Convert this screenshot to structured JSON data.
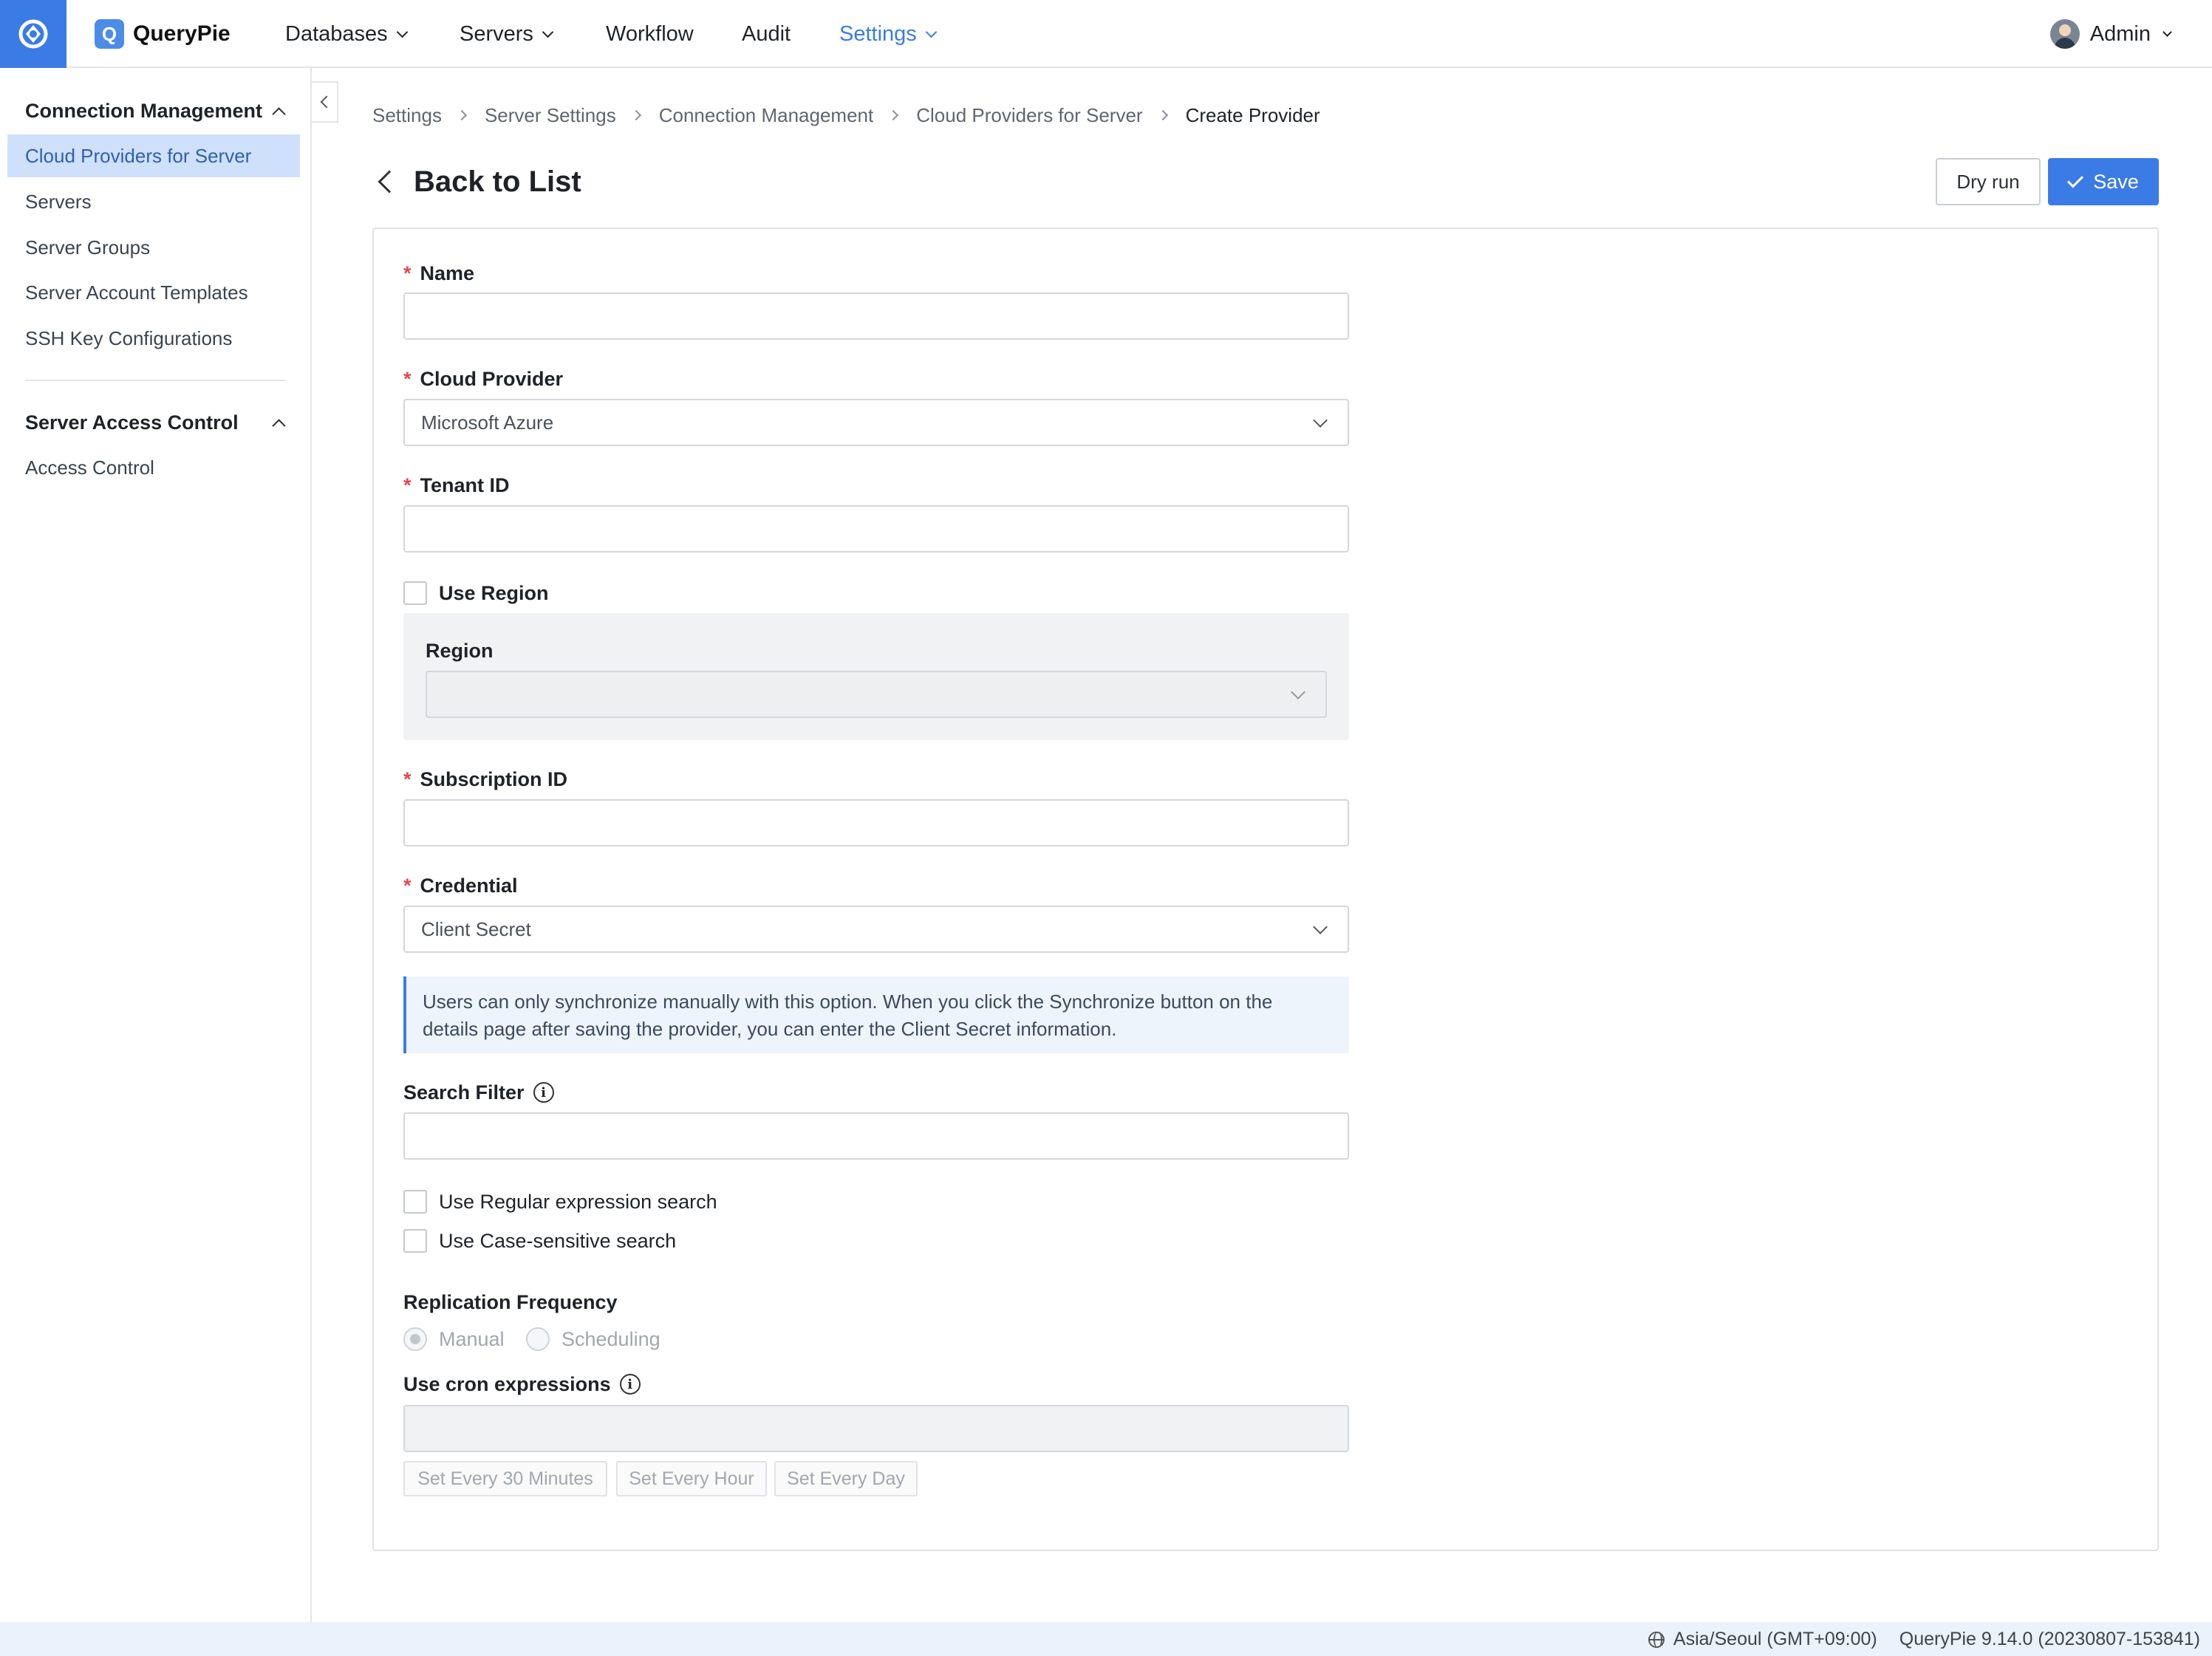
{
  "app": {
    "name": "QueryPie"
  },
  "nav": {
    "databases": "Databases",
    "servers": "Servers",
    "workflow": "Workflow",
    "audit": "Audit",
    "settings": "Settings"
  },
  "user": {
    "name": "Admin"
  },
  "sidebar": {
    "section1": "Connection Management",
    "items": [
      "Cloud Providers for Server",
      "Servers",
      "Server Groups",
      "Server Account Templates",
      "SSH Key Configurations"
    ],
    "section2": "Server Access Control",
    "items2": [
      "Access Control"
    ]
  },
  "breadcrumb": [
    "Settings",
    "Server Settings",
    "Connection Management",
    "Cloud Providers for Server",
    "Create Provider"
  ],
  "header": {
    "back_label": "Back to List",
    "dry_run": "Dry run",
    "save": "Save"
  },
  "form": {
    "name_label": "Name",
    "name_value": "",
    "cloud_provider_label": "Cloud Provider",
    "cloud_provider_value": "Microsoft Azure",
    "tenant_label": "Tenant ID",
    "tenant_value": "",
    "use_region_label": "Use Region",
    "region_label": "Region",
    "region_value": "",
    "subscription_label": "Subscription ID",
    "subscription_value": "",
    "credential_label": "Credential",
    "credential_value": "Client Secret",
    "credential_info": "Users can only synchronize manually with this option. When you click the Synchronize button on the details page after saving the provider, you can enter the Client Secret information.",
    "search_filter_label": "Search Filter",
    "search_filter_value": "",
    "regex_label": "Use Regular expression search",
    "case_label": "Use Case-sensitive search",
    "replication_label": "Replication Frequency",
    "manual_label": "Manual",
    "scheduling_label": "Scheduling",
    "cron_label": "Use cron expressions",
    "cron_value": "",
    "preset_30m": "Set Every 30 Minutes",
    "preset_hour": "Set Every Hour",
    "preset_day": "Set Every Day"
  },
  "footer": {
    "timezone": "Asia/Seoul (GMT+09:00)",
    "version": "QueryPie 9.14.0 (20230807-153841)"
  },
  "colors": {
    "accent": "#3b7be6",
    "active_bg": "#cfe0fb",
    "required": "#e5484d"
  }
}
